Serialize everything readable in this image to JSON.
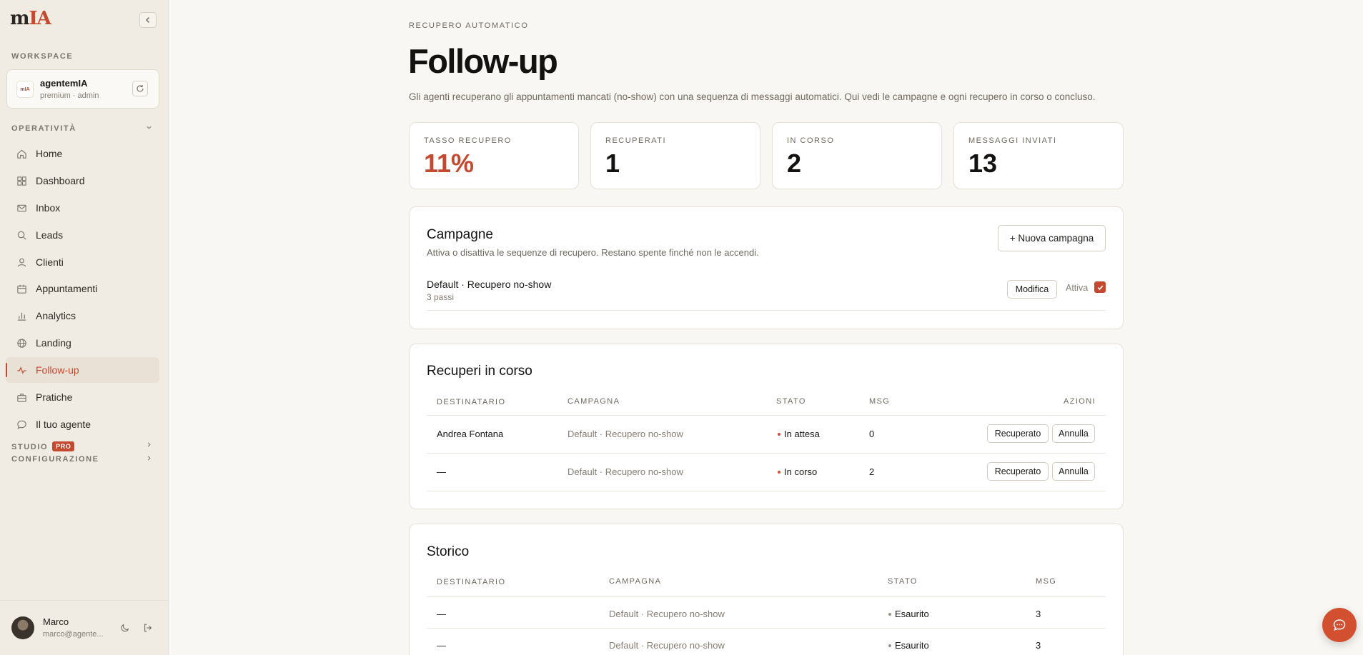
{
  "sidebar": {
    "logo": {
      "part1": "m",
      "part2": "IA"
    },
    "workspace_label": "WORKSPACE",
    "workspace": {
      "avatar_text": "mIA",
      "name": "agentemIA",
      "role": "premium · admin"
    },
    "operativita_label": "OPERATIVITÀ",
    "items": [
      {
        "label": "Home",
        "icon": "home-icon"
      },
      {
        "label": "Dashboard",
        "icon": "grid-icon"
      },
      {
        "label": "Inbox",
        "icon": "mail-icon"
      },
      {
        "label": "Leads",
        "icon": "search-icon"
      },
      {
        "label": "Clienti",
        "icon": "user-icon"
      },
      {
        "label": "Appuntamenti",
        "icon": "calendar-icon"
      },
      {
        "label": "Analytics",
        "icon": "bar-chart-icon"
      },
      {
        "label": "Landing",
        "icon": "globe-icon"
      },
      {
        "label": "Follow-up",
        "icon": "activity-icon",
        "active": true
      },
      {
        "label": "Pratiche",
        "icon": "briefcase-icon"
      },
      {
        "label": "Il tuo agente",
        "icon": "chat-icon"
      }
    ],
    "studio_label": "STUDIO",
    "studio_badge": "PRO",
    "config_label": "CONFIGURAZIONE",
    "user": {
      "name": "Marco",
      "email": "marco@agente..."
    }
  },
  "header": {
    "eyebrow": "RECUPERO AUTOMATICO",
    "title": "Follow-up",
    "description": "Gli agenti recuperano gli appuntamenti mancati (no-show) con una sequenza di messaggi automatici. Qui vedi le campagne e ogni recupero in corso o concluso."
  },
  "stats": [
    {
      "label": "TASSO RECUPERO",
      "value": "11%"
    },
    {
      "label": "RECUPERATI",
      "value": "1"
    },
    {
      "label": "IN CORSO",
      "value": "2"
    },
    {
      "label": "MESSAGGI INVIATI",
      "value": "13"
    }
  ],
  "campaigns": {
    "title": "Campagne",
    "subtitle": "Attiva o disattiva le sequenze di recupero. Restano spente finché non le accendi.",
    "new_button": "+ Nuova campagna",
    "item": {
      "name": "Default · Recupero no-show",
      "steps": "3 passi",
      "edit": "Modifica",
      "active_label": "Attiva",
      "active": true
    }
  },
  "in_progress": {
    "title": "Recuperi in corso",
    "headers": [
      "DESTINATARIO",
      "CAMPAGNA",
      "STATO",
      "MSG",
      "AZIONI"
    ],
    "rows": [
      {
        "recipient": "Andrea Fontana",
        "campaign": "Default · Recupero no-show",
        "status": "In attesa",
        "msg": "0",
        "action1": "Recuperato",
        "action2": "Annulla"
      },
      {
        "recipient": "—",
        "campaign": "Default · Recupero no-show",
        "status": "In corso",
        "msg": "2",
        "action1": "Recuperato",
        "action2": "Annulla"
      }
    ]
  },
  "history": {
    "title": "Storico",
    "headers": [
      "DESTINATARIO",
      "CAMPAGNA",
      "STATO",
      "MSG"
    ],
    "rows": [
      {
        "recipient": "—",
        "campaign": "Default · Recupero no-show",
        "status": "Esaurito",
        "msg": "3"
      },
      {
        "recipient": "—",
        "campaign": "Default · Recupero no-show",
        "status": "Esaurito",
        "msg": "3"
      }
    ]
  },
  "colors": {
    "accent": "#c4492e",
    "status_active": "#d2502f",
    "status_done": "#9b948a"
  }
}
